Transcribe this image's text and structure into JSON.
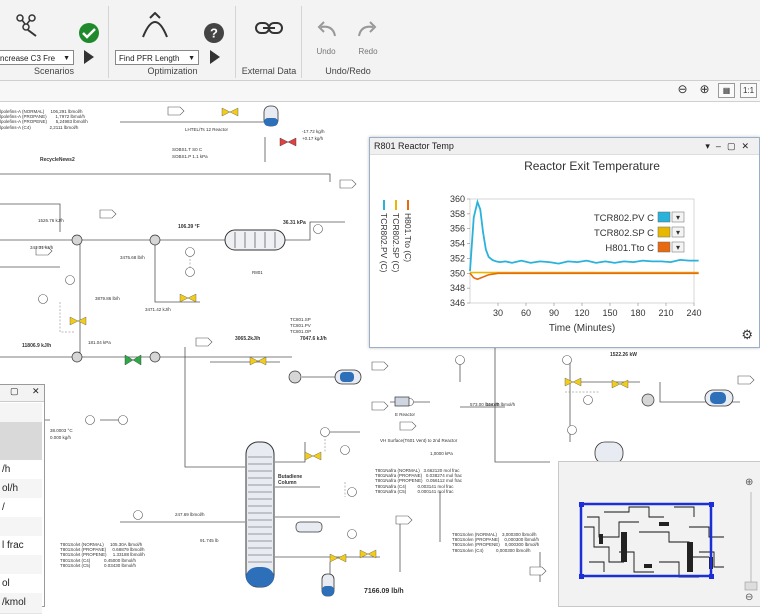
{
  "ribbon": {
    "groups": {
      "scenarios": {
        "label": "Scenarios",
        "dropdown": "ncrease C3 Fre"
      },
      "optimization": {
        "label": "Optimization",
        "dropdown": "Find PFR Length"
      },
      "external": {
        "label": "External Data"
      },
      "undo": {
        "label": "Undo/Redo",
        "undo_label": "Undo",
        "redo_label": "Redo"
      }
    }
  },
  "zoom_toolbar": {
    "fit_label": "1:1"
  },
  "flowsheet": {
    "stream_top_left": "lpolefins-A (NORMAL)     106,291 lbmol/h\nlpolefins-A (PROPANE)       1,7972 lbmol/h\nlpolefins-A (PROPENE)       5,24983 lbmol/h\nlpolefins-A (C4)               2,2111 lbmol/h",
    "recycle_label": "RecycleNews2",
    "rate_1": "1526.76 kJ/h",
    "rate_2": "341.31 kJ/h",
    "rate_3": "3475.68 lb/h",
    "rate_4": "3879.86 lb/h",
    "rate_5": "11806.9 kJ/h",
    "rate_6": "181.04 kPa",
    "temp_1": "106.39 °F",
    "temp_2": "3471.42 kJ/h",
    "press_1": "36.31 kPa",
    "reactor_label": "R801",
    "stream_top_mid": "LHTEL/Ts 12 Reactor",
    "top_vals_1": "SOBS1.T    S0 C",
    "top_vals_2": "SOBS1.P    1.1 kPa",
    "top_right_1": "-17.72 kg/h",
    "top_right_2": "+0.17 kg/h",
    "bottom_left_1": "38.0003 °C",
    "bottom_left_2": "0.000 kg/h",
    "btu_1": "3065.2kJ/h",
    "btu_2": "7047.6 kJ/h",
    "mass_1": "573.00 lbmol/h",
    "mass_2": "247.69 lbmol/h",
    "mass_3": "91.745 lb",
    "column_label": "Butadiene Column",
    "mid_stream": "T801Nafra (NORMAL)   3.662120 mol frac\nT801Nafra (PROPANE)   0.038274 mol frac\nT801Nafra (PROPENE)   0.056112 mol frac\nT801Nafra (C4)         0.003141 mol frac\nT801Nafra (C5)         0.000141 mol frac",
    "lower_stream": "T801Solvt (NORMAL)     105.30A lbmol/h\nT801Solvt (PROPANE)     0.68879 lbmol/h\nT801Solvt (PROPENE)     1.33188 lbmol/h\nT801Solvt (C4)           0.45000 lbmol/h\nT801Solvt (C5)           0.03430 lbmol/h",
    "right_stream": "T801Solvn (NORMAL)    3,000300 lbmol/h\nT801Solvn (PROPANE)    0,000300 lbmol/h\nT801Solvn (PROPENE)    0,000300 lbmol/h\nT801Solvn (C4)          0,000300 lbmol/h",
    "big_value": "7166.09 lb/h",
    "rate_right_1": "1522.26 kW",
    "vap_label": "VH Surface(T601 Vent) to 2nd Reactor",
    "hx_label": "E Reactor",
    "temp_mid": "114.85 lbmol/h",
    "hot_label": "1,0000 kPa",
    "rxn_vals_1": "TC801.SP",
    "rxn_vals_2": "TC801.PV",
    "rxn_vals_3": "TC801.OP"
  },
  "trend_window": {
    "title": "R801 Reactor Temp",
    "chart_title": "Reactor Exit Temperature",
    "legend": [
      "TCR802.PV C",
      "TCR802.SP C",
      "H801.Tto C"
    ],
    "left_legend": [
      "TCR802.PV (C)",
      "TCR802.SP (C)",
      "H801.Tto (C)"
    ],
    "xlabel": "Time (Minutes)"
  },
  "left_panel": {
    "rows": [
      "",
      "",
      "",
      "/h",
      "ol/h",
      "/",
      "",
      "l frac",
      "",
      "ol",
      "/kmol"
    ]
  },
  "colors": {
    "pv": "#29b2dc",
    "sp": "#e8b800",
    "tto": "#e86a10",
    "minimap_frame": "#1c2fd6"
  },
  "chart_data": {
    "type": "line",
    "title": "Reactor Exit Temperature",
    "xlabel": "Time (Minutes)",
    "ylabel": "",
    "xlim": [
      0,
      240
    ],
    "ylim": [
      346,
      360
    ],
    "xticks": [
      30,
      60,
      90,
      120,
      150,
      180,
      210,
      240
    ],
    "yticks": [
      346,
      348,
      350,
      352,
      354,
      356,
      358,
      360
    ],
    "legend_position": "right",
    "series": [
      {
        "name": "TCR802.PV C",
        "color": "#29b2dc",
        "x": [
          0,
          4,
          8,
          11,
          14,
          17,
          20,
          24,
          28,
          32,
          38,
          45,
          55,
          65,
          75,
          85,
          95,
          105,
          115,
          125,
          135,
          145,
          155,
          165,
          175,
          185,
          195,
          205,
          215,
          225,
          235,
          245
        ],
        "y": [
          350.3,
          357.5,
          359.6,
          358.6,
          355.5,
          353.2,
          352.2,
          351.8,
          351.6,
          351.5,
          351.6,
          351.4,
          351.7,
          351.4,
          351.6,
          351.5,
          351.3,
          351.6,
          351.5,
          351.7,
          351.4,
          351.6,
          351.4,
          351.6,
          351.5,
          351.7,
          351.6,
          351.6,
          351.5,
          351.8,
          351.7,
          351.7
        ]
      },
      {
        "name": "TCR802.SP C",
        "color": "#e8b800",
        "x": [
          0,
          245
        ],
        "y": [
          350.1,
          350.1
        ]
      },
      {
        "name": "H801.Tto C",
        "color": "#e86a10",
        "x": [
          0,
          4,
          8,
          12,
          16,
          20,
          25,
          30,
          40,
          60,
          100,
          150,
          200,
          245
        ],
        "y": [
          350.0,
          349.4,
          349.2,
          349.4,
          349.6,
          349.8,
          349.9,
          350.0,
          350.0,
          350.0,
          350.0,
          350.0,
          350.0,
          350.0
        ]
      }
    ]
  }
}
